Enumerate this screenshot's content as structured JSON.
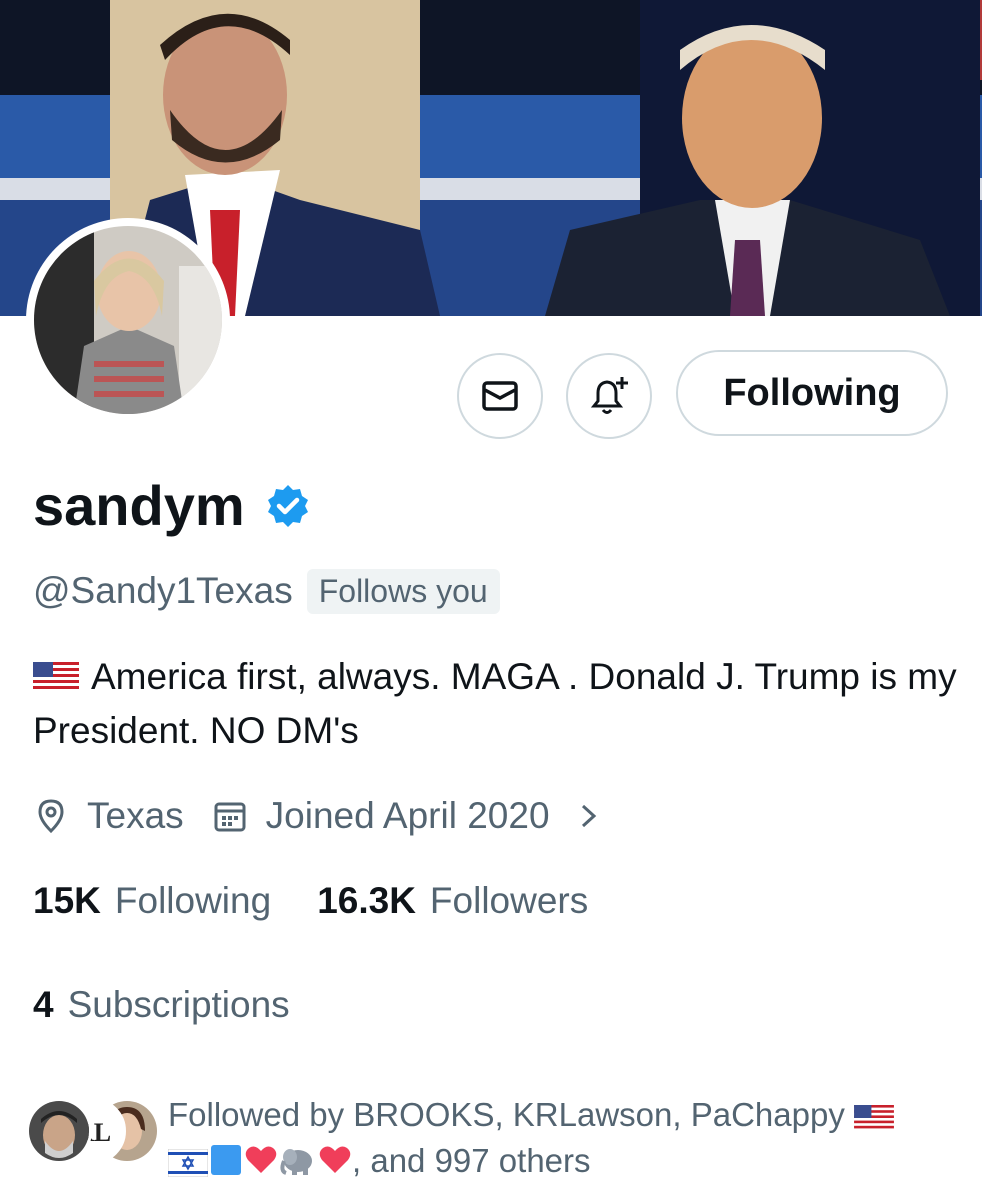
{
  "profile": {
    "display_name": "sandym",
    "handle": "@Sandy1Texas",
    "follows_you_badge": "Follows you",
    "bio": "America first, always. MAGA . Donald J. Trump is my President. NO DM's",
    "location": "Texas",
    "joined": "Joined April 2020"
  },
  "actions": {
    "following_label": "Following"
  },
  "stats": {
    "following_count": "15K",
    "following_label": "Following",
    "followers_count": "16.3K",
    "followers_label": "Followers",
    "subscriptions_count": "4",
    "subscriptions_label": "Subscriptions"
  },
  "followed_by": {
    "prefix": "Followed by BROOKS, KRLawson, PaChappy",
    "suffix": ", and 997 others",
    "avatar_text": "RL"
  },
  "colors": {
    "verified": "#1d9bf0",
    "secondary_text": "#536471",
    "primary_text": "#0f1419",
    "border": "#cfd9de"
  },
  "icons": [
    "banner-photo",
    "avatar-photo",
    "mail-icon",
    "bell-plus-icon",
    "verified-badge-icon",
    "us-flag-icon",
    "location-pin-icon",
    "calendar-icon",
    "chevron-right-icon",
    "israel-flag-icon",
    "blue-square-icon",
    "heart-icon",
    "elephant-icon"
  ]
}
